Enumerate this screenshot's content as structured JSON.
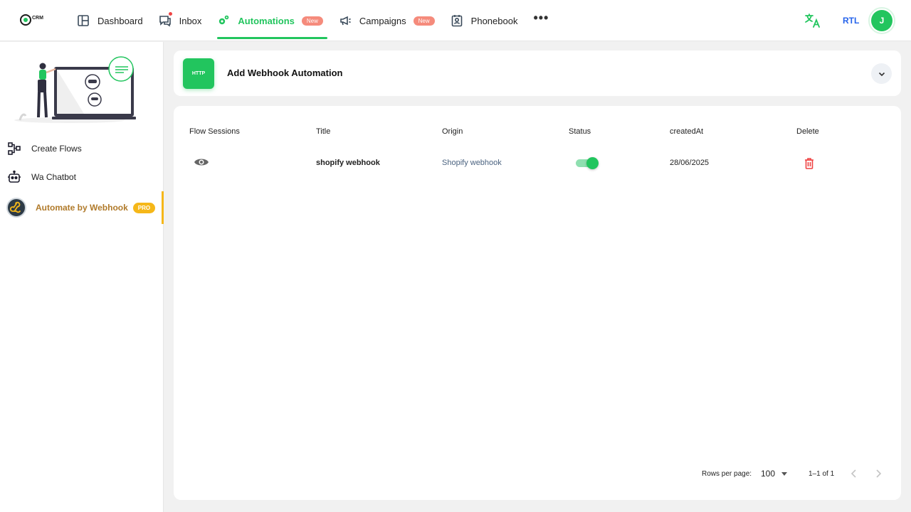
{
  "header": {
    "logo_text": "CRM",
    "nav": [
      {
        "label": "Dashboard"
      },
      {
        "label": "Inbox"
      },
      {
        "label": "Automations",
        "badge": "New"
      },
      {
        "label": "Campaigns",
        "badge": "New"
      },
      {
        "label": "Phonebook"
      }
    ],
    "more": "•••",
    "rtl": "RTL",
    "avatar_initial": "J"
  },
  "sidebar": {
    "items": [
      {
        "label": "Create Flows",
        "icon": "flow-icon"
      },
      {
        "label": "Wa Chatbot",
        "icon": "robot-icon"
      },
      {
        "label": "Automate by Webhook",
        "icon": "webhook-icon",
        "badge": "PRO",
        "active": true
      }
    ]
  },
  "add_card": {
    "icon_text": "HTTP",
    "title": "Add Webhook Automation"
  },
  "table": {
    "headers": [
      "Flow Sessions",
      "Title",
      "Origin",
      "Status",
      "createdAt",
      "Delete"
    ],
    "rows": [
      {
        "title": "shopify webhook",
        "origin": "Shopify webhook",
        "status_on": true,
        "created_at": "28/06/2025"
      }
    ]
  },
  "pagination": {
    "rows_per_page_label": "Rows per page:",
    "rows_per_page": "100",
    "range": "1–1 of 1"
  },
  "colors": {
    "accent": "#22c55e",
    "pro": "#f5b719",
    "danger": "#ef4444",
    "link": "#2563eb"
  }
}
